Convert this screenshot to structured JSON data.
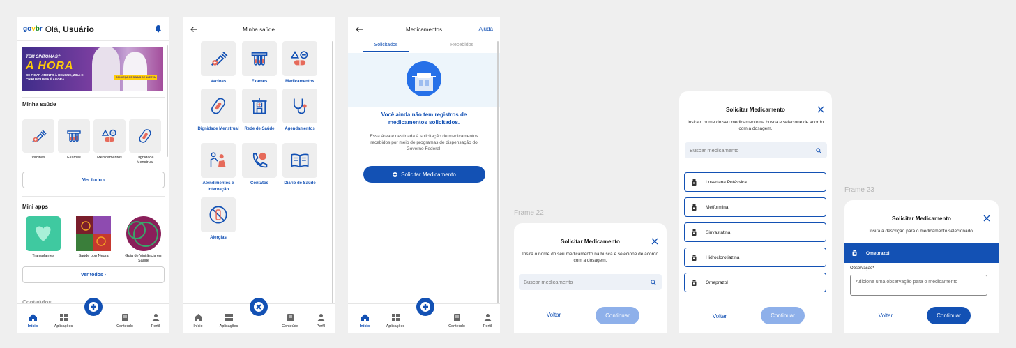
{
  "screen1": {
    "logo": "gov.br",
    "greeting": "Olá,",
    "user": "Usuário",
    "banner": {
      "line1": "TEM SINTOMAS?",
      "line2": "A HORA",
      "line3": "DE FICAR ATENTO À DENGUE, ZIKA E CHIKUNGUNYA É AGORA.",
      "badge": "CONHEÇA OS SINAIS DE ALERTA"
    },
    "section_health": "Minha saúde",
    "health_tiles": [
      "Vacinas",
      "Exames",
      "Medicamentos",
      "Dignidade Menstrual"
    ],
    "see_all": "Ver tudo",
    "section_apps": "Mini apps",
    "apps": [
      "Transplantes",
      "Saúde pop Negra",
      "Guia de Vigilância em Saúde"
    ],
    "see_all_apps": "Ver todos",
    "section_next": "Conteúdos"
  },
  "nav": {
    "home": "Início",
    "apps": "Aplicações",
    "content": "Conteúdo",
    "profile": "Perfil"
  },
  "screen2": {
    "title": "Minha saúde",
    "tiles": [
      "Vacinas",
      "Exames",
      "Medicamentos",
      "Dignidade Menstrual",
      "Rede de Saúde",
      "Agendamentos",
      "Atendimentos e internação",
      "Contatos",
      "Diário de Saúde",
      "Alergias"
    ]
  },
  "screen3": {
    "title": "Medicamentos",
    "help": "Ajuda",
    "tab_requested": "Solicitados",
    "tab_received": "Recebidos",
    "empty_title": "Você ainda não tem registros de medicamentos solicitados.",
    "empty_desc": "Essa área é destinada à solicitação de medicamentos recebidos por meio de programas de dispensação do Governo Federal.",
    "cta": "Solicitar Medicamento"
  },
  "frame22": {
    "label": "Frame 22",
    "title": "Solicitar Medicamento",
    "desc": "Insira o nome do seu medicamento na busca e selecione de acordo com a dosagem.",
    "search_placeholder": "Buscar medicamento",
    "back": "Voltar",
    "continue": "Continuar"
  },
  "frame_list": {
    "title": "Solicitar Medicamento",
    "desc": "Insira o nome do seu medicamento na busca e selecione de acordo com a dosagem.",
    "search_placeholder": "Buscar medicamento",
    "items": [
      "Losartana Potássica",
      "Metformina",
      "Sinvastatina",
      "Hidroclorotiazina",
      "Omeprazol"
    ],
    "back": "Voltar",
    "continue": "Continuar"
  },
  "frame23": {
    "label": "Frame 23",
    "title": "Solicitar Medicamento",
    "desc": "Insira a descrição para o medicamento selecionado.",
    "selected": "Omeprazol",
    "obs_label": "Observação*",
    "obs_placeholder": "Adicione uma observação para o medicamento",
    "back": "Voltar",
    "continue": "Continuar"
  },
  "colors": {
    "primary": "#1351b4",
    "disabled": "#8eb0ea",
    "tile_bg": "#eeeeee",
    "page_bg": "#efefef"
  }
}
